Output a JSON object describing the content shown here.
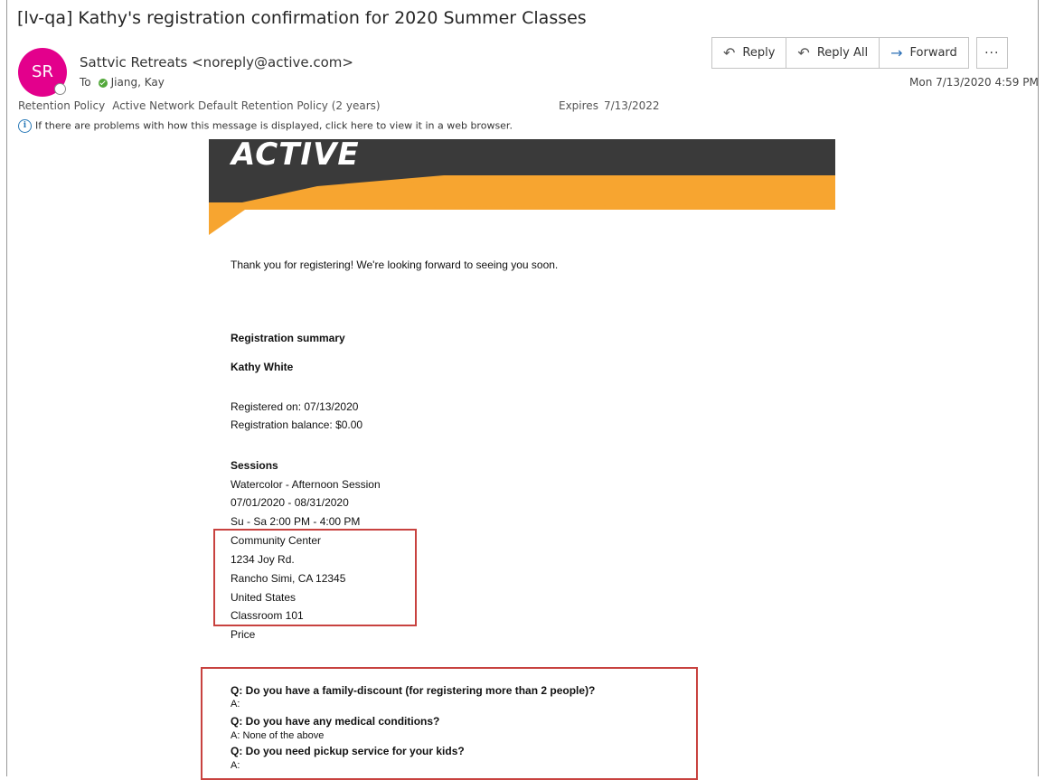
{
  "email": {
    "subject": "[lv-qa] Kathy's registration confirmation for 2020 Summer Classes",
    "avatar_initials": "SR",
    "sender": "Sattvic Retreats <noreply@active.com>",
    "to_label": "To",
    "to_name": "Jiang, Kay",
    "retention_label": "Retention Policy",
    "retention_value": "Active Network Default Retention Policy (2 years)",
    "expires_label": "Expires",
    "expires_value": "7/13/2022",
    "info_text": "If there are problems with how this message is displayed, click here to view it in a web browser.",
    "datetime": "Mon 7/13/2020 4:59 PM"
  },
  "toolbar": {
    "reply": "Reply",
    "reply_all": "Reply All",
    "forward": "Forward",
    "more": "···"
  },
  "content": {
    "logo": "ACTIVE",
    "thank_you": "Thank you for registering! We're looking forward to seeing you soon.",
    "summary_heading": "Registration summary",
    "registrant": "Kathy White",
    "registered_on": "Registered on: 07/13/2020",
    "balance": "Registration balance: $0.00",
    "sessions_heading": "Sessions",
    "session_name": "Watercolor - Afternoon Session",
    "session_dates": "07/01/2020 - 08/31/2020",
    "session_time": "Su - Sa 2:00 PM - 4:00 PM",
    "location": {
      "venue": "Community Center",
      "street": "1234 Joy Rd.",
      "city": "Rancho Simi, CA 12345",
      "country": "United States",
      "room": "Classroom 101"
    },
    "price_label": "Price",
    "questions": [
      {
        "q": "Q: Do you have a family-discount (for registering more than 2 people)?",
        "a": "A:"
      },
      {
        "q": "Q: Do you have any medical conditions?",
        "a": "A:  None of the above"
      },
      {
        "q": "Q: Do you need pickup service for your kids?",
        "a": "A:"
      }
    ]
  },
  "colors": {
    "avatar": "#e3008c",
    "banner_dark": "#3a3a3a",
    "banner_orange": "#f7a530",
    "highlight_box": "#c8423f"
  }
}
